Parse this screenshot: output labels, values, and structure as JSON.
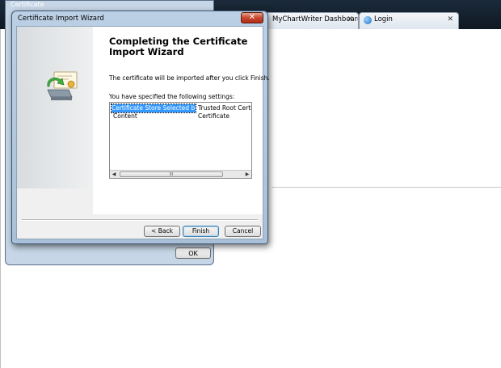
{
  "browser": {
    "tabs": [
      {
        "label": "MyChartWriter Dashboard",
        "close": "✕"
      },
      {
        "label": "Login",
        "close": "✕"
      }
    ]
  },
  "bg_window": {
    "title": "Certificate",
    "ok_label": "OK"
  },
  "wizard": {
    "title": "Certificate Import Wizard",
    "close_glyph": "✕",
    "heading": "Completing the Certificate Import Wizard",
    "description": "The certificate will be imported after you click Finish.",
    "settings_label": "You have specified the following settings:",
    "settings": [
      {
        "name": "Certificate Store Selected by User",
        "value": "Trusted Root Certifica"
      },
      {
        "name": "Content",
        "value": "Certificate"
      }
    ],
    "scroll_thumb": "III",
    "scroll_left": "◀",
    "scroll_right": "▶",
    "buttons": {
      "back": "< Back",
      "finish": "Finish",
      "cancel": "Cancel"
    }
  },
  "colors": {
    "selection": "#3399ff",
    "close_button": "#c7452d",
    "window_frame": "#a9c0d8"
  }
}
